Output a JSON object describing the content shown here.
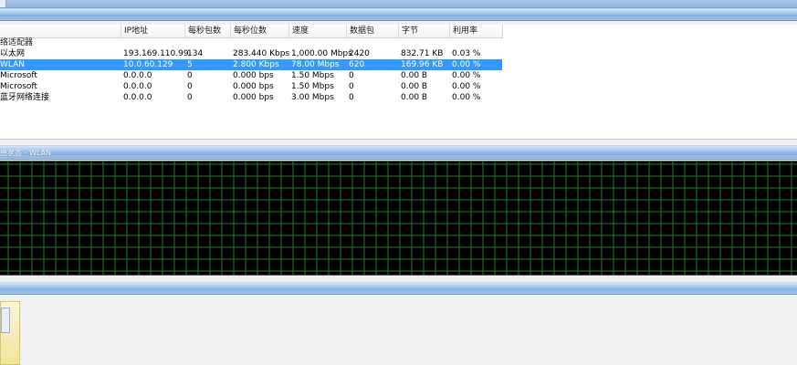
{
  "adapters_panel": {
    "group_label": "络适配器",
    "columns": [
      "IP地址",
      "每秒包数",
      "每秒位数",
      "速度",
      "数据包",
      "字节",
      "利用率"
    ],
    "rows": [
      {
        "name": "以太网",
        "ip": "193.169.110.99",
        "pps": "134",
        "bps": "283.440 Kbps",
        "speed": "1,000.00 Mbps",
        "packets": "2420",
        "bytes": "832.71 KB",
        "util": "0.03 %",
        "selected": false
      },
      {
        "name": "WLAN",
        "ip": "10.0.60.129",
        "pps": "5",
        "bps": "2.800 Kbps",
        "speed": "78.00 Mbps",
        "packets": "620",
        "bytes": "169.96 KB",
        "util": "0.00 %",
        "selected": true
      },
      {
        "name": "Microsoft",
        "ip": "0.0.0.0",
        "pps": "0",
        "bps": "0.000 bps",
        "speed": "1.50 Mbps",
        "packets": "0",
        "bytes": "0.00 B",
        "util": "0.00 %",
        "selected": false
      },
      {
        "name": "Microsoft",
        "ip": "0.0.0.0",
        "pps": "0",
        "bps": "0.000 bps",
        "speed": "1.50 Mbps",
        "packets": "0",
        "bytes": "0.00 B",
        "util": "0.00 %",
        "selected": false
      },
      {
        "name": "蓝牙网络连接",
        "ip": "0.0.0.0",
        "pps": "0",
        "bps": "0.000 bps",
        "speed": "3.00 Mbps",
        "packets": "0",
        "bytes": "0.00 B",
        "util": "0.00 %",
        "selected": false
      }
    ]
  },
  "graph_panel": {
    "title": "络状态 - WLAN"
  },
  "colors": {
    "graph_background": "#000000",
    "grid_line": "#1f7a2a",
    "selection": "#3399ff",
    "header_bar": "#86afe2"
  }
}
